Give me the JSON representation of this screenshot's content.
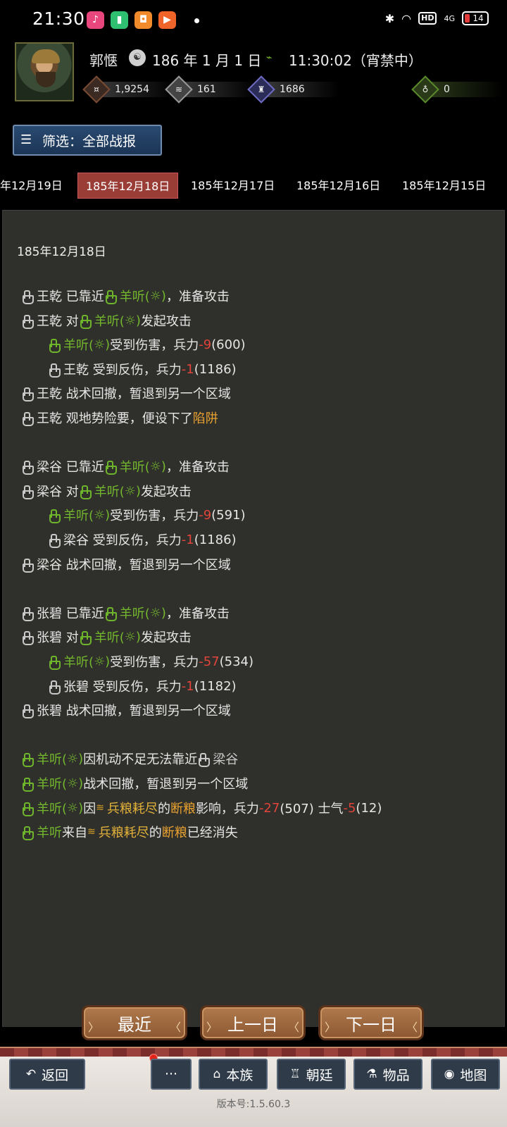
{
  "status_bar": {
    "time": "21:30",
    "battery": "14",
    "network": "4G",
    "hd": "HD",
    "apps": [
      {
        "icon": "music-app-icon",
        "color": "#e8467c",
        "glyph": "♪"
      },
      {
        "icon": "clipboard-app-icon",
        "color": "#2fbf71",
        "glyph": "▮"
      },
      {
        "icon": "game-app-icon",
        "color": "#f08a2a",
        "glyph": "◘"
      },
      {
        "icon": "video-app-icon",
        "color": "#f0642a",
        "glyph": "▶"
      }
    ]
  },
  "header": {
    "hero_name": "郭惬",
    "date": "186 年 1 月 1 日",
    "time": "11:30:02（宵禁中）",
    "resources": [
      {
        "icon": "coin-icon",
        "value": "1,9254",
        "color": "#7a4a33"
      },
      {
        "icon": "grain-icon",
        "value": "161",
        "color": "#8a8a8a"
      },
      {
        "icon": "soldier-icon",
        "value": "1686",
        "color": "#5b5bb5"
      },
      {
        "icon": "money-bag-icon",
        "value": "0",
        "color": "#5a8a2a"
      }
    ]
  },
  "filter": {
    "label": "筛选：全部战报"
  },
  "date_tabs": [
    "年12月19日",
    "185年12月18日",
    "185年12月17日",
    "185年12月16日",
    "185年12月15日"
  ],
  "selected_tab": "185年12月18日",
  "log": {
    "date": "185年12月18日",
    "lines": [
      {
        "indent": false,
        "parts": [
          {
            "hand": "w"
          },
          {
            "t": "王乾 已靠近 "
          },
          {
            "hand": "g"
          },
          {
            "t": "羊听(",
            "c": "green"
          },
          {
            "t": "☼",
            "c": "green"
          },
          {
            "t": ")",
            "c": "green"
          },
          {
            "t": "，准备攻击"
          }
        ]
      },
      {
        "indent": false,
        "parts": [
          {
            "hand": "w"
          },
          {
            "t": "王乾 对 "
          },
          {
            "hand": "g"
          },
          {
            "t": "羊听(",
            "c": "green"
          },
          {
            "t": "☼",
            "c": "green"
          },
          {
            "t": ")",
            "c": "green"
          },
          {
            "t": " 发起攻击"
          }
        ]
      },
      {
        "indent": true,
        "parts": [
          {
            "hand": "g"
          },
          {
            "t": "羊听(",
            "c": "green"
          },
          {
            "t": "☼",
            "c": "green"
          },
          {
            "t": ")",
            "c": "green"
          },
          {
            "t": " 受到伤害，兵力 "
          },
          {
            "t": "-9",
            "c": "red"
          },
          {
            "t": " (600)"
          }
        ]
      },
      {
        "indent": true,
        "parts": [
          {
            "hand": "w"
          },
          {
            "t": "王乾 受到反伤，兵力 "
          },
          {
            "t": "-1",
            "c": "red"
          },
          {
            "t": " (1186)"
          }
        ]
      },
      {
        "indent": false,
        "parts": [
          {
            "hand": "w"
          },
          {
            "t": "王乾 战术回撤，暂退到另一个区域"
          }
        ]
      },
      {
        "indent": false,
        "parts": [
          {
            "hand": "w"
          },
          {
            "t": "王乾 观地势险要，便设下了 "
          },
          {
            "t": "陷阱",
            "c": "orange"
          }
        ]
      },
      {
        "blank": true
      },
      {
        "indent": false,
        "parts": [
          {
            "hand": "w"
          },
          {
            "t": "梁谷 已靠近 "
          },
          {
            "hand": "g"
          },
          {
            "t": "羊听(",
            "c": "green"
          },
          {
            "t": "☼",
            "c": "green"
          },
          {
            "t": ")",
            "c": "green"
          },
          {
            "t": "，准备攻击"
          }
        ]
      },
      {
        "indent": false,
        "parts": [
          {
            "hand": "w"
          },
          {
            "t": "梁谷 对 "
          },
          {
            "hand": "g"
          },
          {
            "t": "羊听(",
            "c": "green"
          },
          {
            "t": "☼",
            "c": "green"
          },
          {
            "t": ")",
            "c": "green"
          },
          {
            "t": " 发起攻击"
          }
        ]
      },
      {
        "indent": true,
        "parts": [
          {
            "hand": "g"
          },
          {
            "t": "羊听(",
            "c": "green"
          },
          {
            "t": "☼",
            "c": "green"
          },
          {
            "t": ")",
            "c": "green"
          },
          {
            "t": " 受到伤害，兵力 "
          },
          {
            "t": "-9",
            "c": "red"
          },
          {
            "t": " (591)"
          }
        ]
      },
      {
        "indent": true,
        "parts": [
          {
            "hand": "w"
          },
          {
            "t": "梁谷 受到反伤，兵力 "
          },
          {
            "t": "-1",
            "c": "red"
          },
          {
            "t": " (1186)"
          }
        ]
      },
      {
        "indent": false,
        "parts": [
          {
            "hand": "w"
          },
          {
            "t": "梁谷 战术回撤，暂退到另一个区域"
          }
        ]
      },
      {
        "blank": true
      },
      {
        "indent": false,
        "parts": [
          {
            "hand": "w"
          },
          {
            "t": "张碧 已靠近 "
          },
          {
            "hand": "g"
          },
          {
            "t": "羊听(",
            "c": "green"
          },
          {
            "t": "☼",
            "c": "green"
          },
          {
            "t": ")",
            "c": "green"
          },
          {
            "t": "，准备攻击"
          }
        ]
      },
      {
        "indent": false,
        "parts": [
          {
            "hand": "w"
          },
          {
            "t": "张碧 对 "
          },
          {
            "hand": "g"
          },
          {
            "t": "羊听(",
            "c": "green"
          },
          {
            "t": "☼",
            "c": "green"
          },
          {
            "t": ")",
            "c": "green"
          },
          {
            "t": " 发起攻击"
          }
        ]
      },
      {
        "indent": true,
        "parts": [
          {
            "hand": "g"
          },
          {
            "t": "羊听(",
            "c": "green"
          },
          {
            "t": "☼",
            "c": "green"
          },
          {
            "t": ")",
            "c": "green"
          },
          {
            "t": " 受到伤害，兵力 "
          },
          {
            "t": "-57",
            "c": "red"
          },
          {
            "t": " (534)"
          }
        ]
      },
      {
        "indent": true,
        "parts": [
          {
            "hand": "w"
          },
          {
            "t": "张碧 受到反伤，兵力 "
          },
          {
            "t": "-1",
            "c": "red"
          },
          {
            "t": " (1182)"
          }
        ]
      },
      {
        "indent": false,
        "parts": [
          {
            "hand": "w"
          },
          {
            "t": "张碧 战术回撤，暂退到另一个区域"
          }
        ]
      },
      {
        "blank": true
      },
      {
        "indent": false,
        "parts": [
          {
            "hand": "g"
          },
          {
            "t": "羊听(",
            "c": "green"
          },
          {
            "t": "☼",
            "c": "green"
          },
          {
            "t": ")",
            "c": "green"
          },
          {
            "t": " 因机动不足无法靠近 "
          },
          {
            "hand": "w"
          },
          {
            "t": "梁谷",
            "c": "white-dim"
          }
        ]
      },
      {
        "indent": false,
        "parts": [
          {
            "hand": "g"
          },
          {
            "t": "羊听(",
            "c": "green"
          },
          {
            "t": "☼",
            "c": "green"
          },
          {
            "t": ")",
            "c": "green"
          },
          {
            "t": " 战术回撤，暂退到另一个区域"
          }
        ]
      },
      {
        "indent": false,
        "parts": [
          {
            "hand": "g"
          },
          {
            "t": "羊听(",
            "c": "green"
          },
          {
            "t": "☼",
            "c": "green"
          },
          {
            "t": ")",
            "c": "green"
          },
          {
            "t": " 因 "
          },
          {
            "grain": true
          },
          {
            "t": "兵粮耗尽",
            "c": "gold"
          },
          {
            "t": " 的 "
          },
          {
            "t": "断粮",
            "c": "orange"
          },
          {
            "t": " 影响，兵力 "
          },
          {
            "t": "-27",
            "c": "red"
          },
          {
            "t": " (507) 士气 "
          },
          {
            "t": "-5",
            "c": "red"
          },
          {
            "t": " (12)"
          }
        ]
      },
      {
        "indent": false,
        "parts": [
          {
            "hand": "g"
          },
          {
            "t": "羊听",
            "c": "green"
          },
          {
            "t": " 来自 "
          },
          {
            "grain": true
          },
          {
            "t": "兵粮耗尽",
            "c": "gold"
          },
          {
            "t": " 的 "
          },
          {
            "t": "断粮",
            "c": "orange"
          },
          {
            "t": " 已经消失"
          }
        ]
      }
    ]
  },
  "nav_buttons": {
    "recent": "最近",
    "prev": "上一日",
    "next": "下一日"
  },
  "bottom_nav": {
    "back": "返回",
    "more": "···",
    "clan": "本族",
    "court": "朝廷",
    "items": "物品",
    "map": "地图"
  },
  "version": "版本号:1.5.60.3"
}
